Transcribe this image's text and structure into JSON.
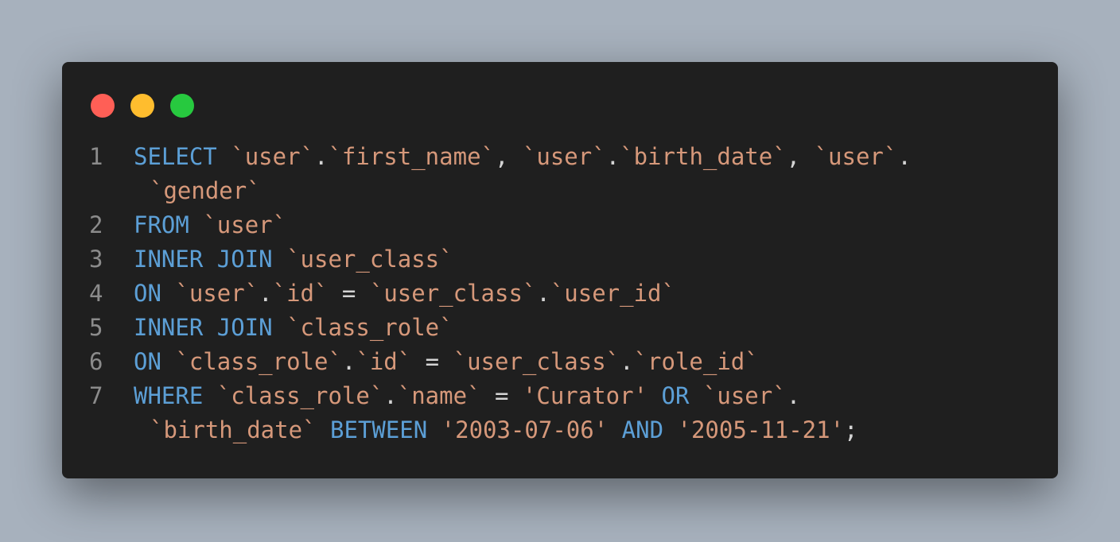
{
  "colors": {
    "background": "#a7b1bd",
    "editor_bg": "#1f1f1f",
    "line_number": "#8b8b8b",
    "keyword": "#5c9fd6",
    "identifier": "#d6987a",
    "punctuation": "#d4d4d4",
    "traffic_red": "#ff5f56",
    "traffic_yellow": "#ffbd2e",
    "traffic_green": "#27c93f"
  },
  "window_controls": [
    "close",
    "minimize",
    "maximize"
  ],
  "code": {
    "lines": [
      {
        "number": "1",
        "rows": [
          [
            [
              "kw",
              "SELECT"
            ],
            [
              "pu",
              " "
            ],
            [
              "id",
              "`user`"
            ],
            [
              "pu",
              "."
            ],
            [
              "id",
              "`first_name`"
            ],
            [
              "pu",
              ", "
            ],
            [
              "id",
              "`user`"
            ],
            [
              "pu",
              "."
            ],
            [
              "id",
              "`birth_date`"
            ],
            [
              "pu",
              ", "
            ],
            [
              "id",
              "`user`"
            ],
            [
              "pu",
              "."
            ]
          ],
          [
            [
              "id",
              "`gender`"
            ]
          ]
        ]
      },
      {
        "number": "2",
        "rows": [
          [
            [
              "kw",
              "FROM"
            ],
            [
              "pu",
              " "
            ],
            [
              "id",
              "`user`"
            ]
          ]
        ]
      },
      {
        "number": "3",
        "rows": [
          [
            [
              "kw",
              "INNER JOIN"
            ],
            [
              "pu",
              " "
            ],
            [
              "id",
              "`user_class`"
            ]
          ]
        ]
      },
      {
        "number": "4",
        "rows": [
          [
            [
              "kw",
              "ON"
            ],
            [
              "pu",
              " "
            ],
            [
              "id",
              "`user`"
            ],
            [
              "pu",
              "."
            ],
            [
              "id",
              "`id`"
            ],
            [
              "pu",
              " = "
            ],
            [
              "id",
              "`user_class`"
            ],
            [
              "pu",
              "."
            ],
            [
              "id",
              "`user_id`"
            ]
          ]
        ]
      },
      {
        "number": "5",
        "rows": [
          [
            [
              "kw",
              "INNER JOIN"
            ],
            [
              "pu",
              " "
            ],
            [
              "id",
              "`class_role`"
            ]
          ]
        ]
      },
      {
        "number": "6",
        "rows": [
          [
            [
              "kw",
              "ON"
            ],
            [
              "pu",
              " "
            ],
            [
              "id",
              "`class_role`"
            ],
            [
              "pu",
              "."
            ],
            [
              "id",
              "`id`"
            ],
            [
              "pu",
              " = "
            ],
            [
              "id",
              "`user_class`"
            ],
            [
              "pu",
              "."
            ],
            [
              "id",
              "`role_id`"
            ]
          ]
        ]
      },
      {
        "number": "7",
        "rows": [
          [
            [
              "kw",
              "WHERE"
            ],
            [
              "pu",
              " "
            ],
            [
              "id",
              "`class_role`"
            ],
            [
              "pu",
              "."
            ],
            [
              "id",
              "`name`"
            ],
            [
              "pu",
              " = "
            ],
            [
              "st",
              "'Curator'"
            ],
            [
              "pu",
              " "
            ],
            [
              "kw",
              "OR"
            ],
            [
              "pu",
              " "
            ],
            [
              "id",
              "`user`"
            ],
            [
              "pu",
              "."
            ]
          ],
          [
            [
              "id",
              "`birth_date`"
            ],
            [
              "pu",
              " "
            ],
            [
              "kw",
              "BETWEEN"
            ],
            [
              "pu",
              " "
            ],
            [
              "st",
              "'2003-07-06'"
            ],
            [
              "pu",
              " "
            ],
            [
              "kw",
              "AND"
            ],
            [
              "pu",
              " "
            ],
            [
              "st",
              "'2005-11-21'"
            ],
            [
              "pu",
              ";"
            ]
          ]
        ]
      }
    ]
  }
}
